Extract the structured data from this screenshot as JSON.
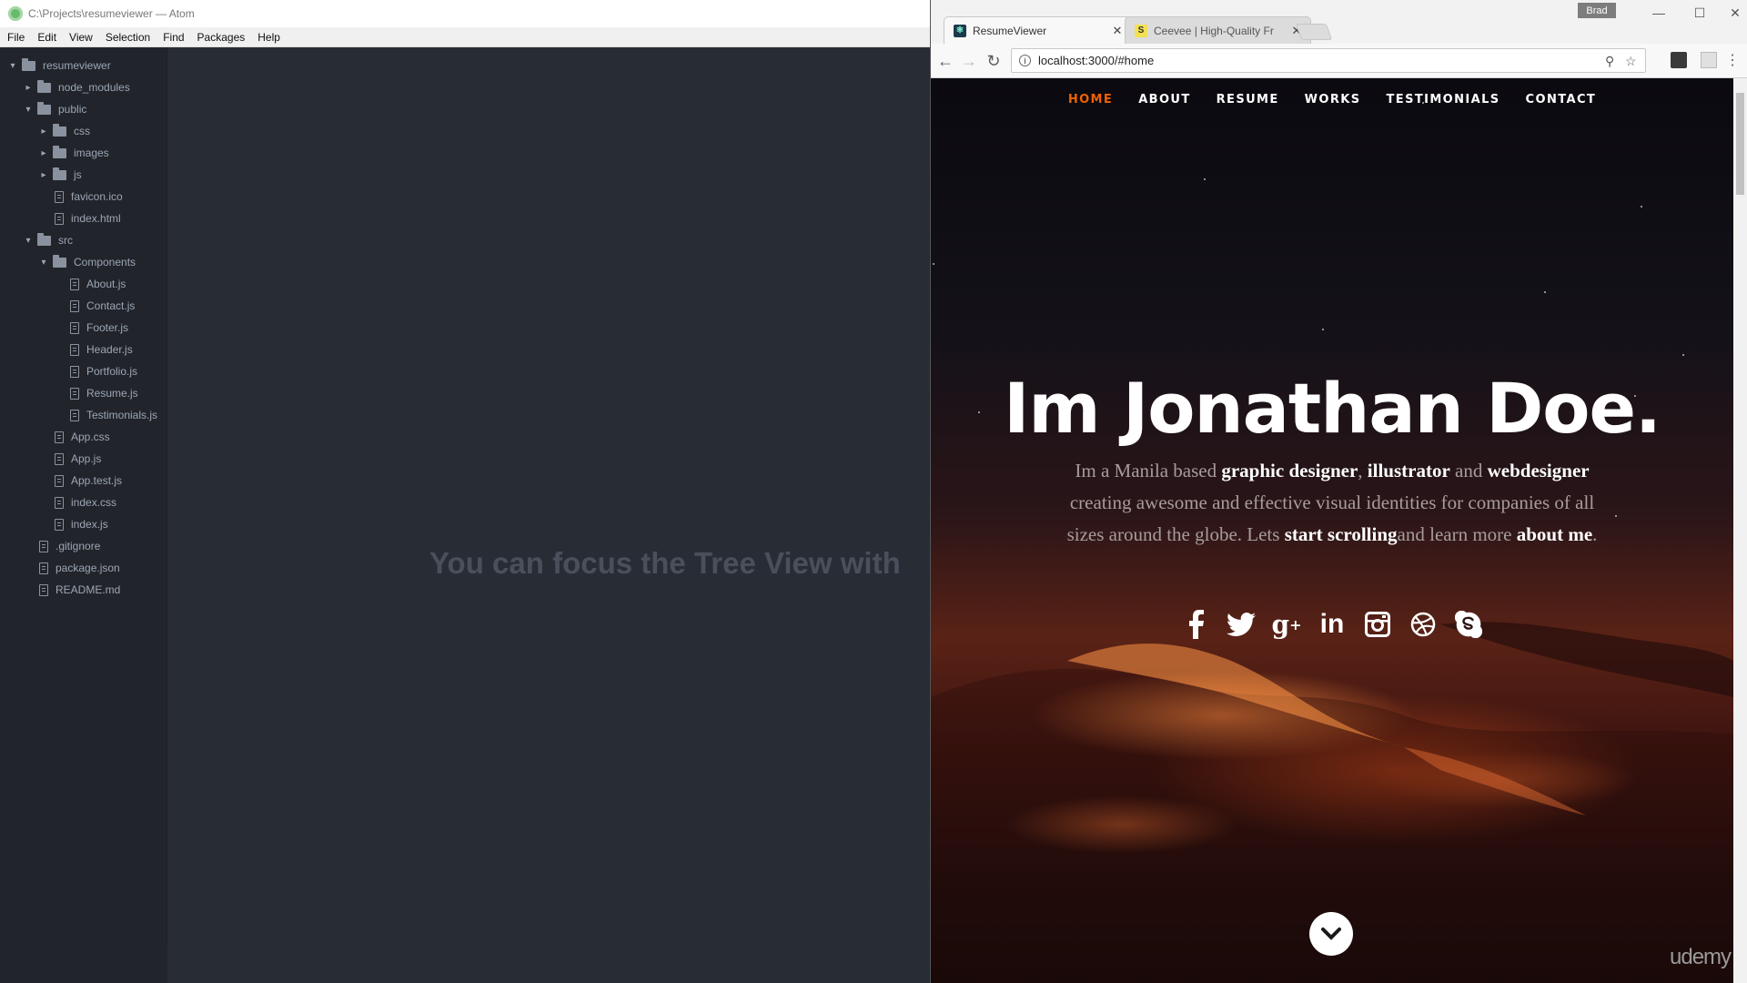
{
  "atom": {
    "window_title": "C:\\Projects\\resumeviewer — Atom",
    "menu": [
      "File",
      "Edit",
      "View",
      "Selection",
      "Find",
      "Packages",
      "Help"
    ],
    "tree": [
      {
        "label": "resumeviewer",
        "type": "folder",
        "depth": 0,
        "expanded": true
      },
      {
        "label": "node_modules",
        "type": "folder",
        "depth": 1,
        "expanded": false
      },
      {
        "label": "public",
        "type": "folder",
        "depth": 1,
        "expanded": true
      },
      {
        "label": "css",
        "type": "folder",
        "depth": 2,
        "expanded": false
      },
      {
        "label": "images",
        "type": "folder",
        "depth": 2,
        "expanded": false
      },
      {
        "label": "js",
        "type": "folder",
        "depth": 2,
        "expanded": false
      },
      {
        "label": "favicon.ico",
        "type": "file",
        "depth": 2
      },
      {
        "label": "index.html",
        "type": "file",
        "depth": 2
      },
      {
        "label": "src",
        "type": "folder",
        "depth": 1,
        "expanded": true
      },
      {
        "label": "Components",
        "type": "folder",
        "depth": 2,
        "expanded": true
      },
      {
        "label": "About.js",
        "type": "file",
        "depth": 3
      },
      {
        "label": "Contact.js",
        "type": "file",
        "depth": 3
      },
      {
        "label": "Footer.js",
        "type": "file",
        "depth": 3
      },
      {
        "label": "Header.js",
        "type": "file",
        "depth": 3
      },
      {
        "label": "Portfolio.js",
        "type": "file",
        "depth": 3
      },
      {
        "label": "Resume.js",
        "type": "file",
        "depth": 3
      },
      {
        "label": "Testimonials.js",
        "type": "file",
        "depth": 3
      },
      {
        "label": "App.css",
        "type": "file",
        "depth": 2
      },
      {
        "label": "App.js",
        "type": "file",
        "depth": 2
      },
      {
        "label": "App.test.js",
        "type": "file",
        "depth": 2
      },
      {
        "label": "index.css",
        "type": "file",
        "depth": 2
      },
      {
        "label": "index.js",
        "type": "file",
        "depth": 2
      },
      {
        "label": ".gitignore",
        "type": "file",
        "depth": 1
      },
      {
        "label": "package.json",
        "type": "file",
        "depth": 1
      },
      {
        "label": "README.md",
        "type": "file",
        "depth": 1
      }
    ],
    "editor_hint": "You can focus the Tree View with"
  },
  "browser": {
    "profile": "Brad",
    "tabs": [
      {
        "title": "ResumeViewer",
        "active": true
      },
      {
        "title": "Ceevee | High-Quality Fr",
        "active": false
      }
    ],
    "url": "localhost:3000/#home"
  },
  "site": {
    "nav": [
      {
        "label": "HOME",
        "active": true
      },
      {
        "label": "ABOUT",
        "active": false
      },
      {
        "label": "RESUME",
        "active": false
      },
      {
        "label": "WORKS",
        "active": false
      },
      {
        "label": "TESTIMONIALS",
        "active": false
      },
      {
        "label": "CONTACT",
        "active": false
      }
    ],
    "hero_title": "Im Jonathan Doe.",
    "hero_text": {
      "t1": "Im a Manila based ",
      "b1": "graphic designer",
      "t2": ", ",
      "b2": "illustrator",
      "t3": " and ",
      "b3": "webdesigner",
      "t4": " creating awesome and effective visual identities for companies of all sizes around the globe. Lets ",
      "b4": "start scrolling",
      "t5": "and learn more ",
      "b5": "about me",
      "t6": "."
    },
    "social": [
      "facebook-icon",
      "twitter-icon",
      "google-plus-icon",
      "linkedin-icon",
      "instagram-icon",
      "dribbble-icon",
      "skype-icon"
    ],
    "accent_color": "#f06000",
    "watermark": "udemy"
  }
}
